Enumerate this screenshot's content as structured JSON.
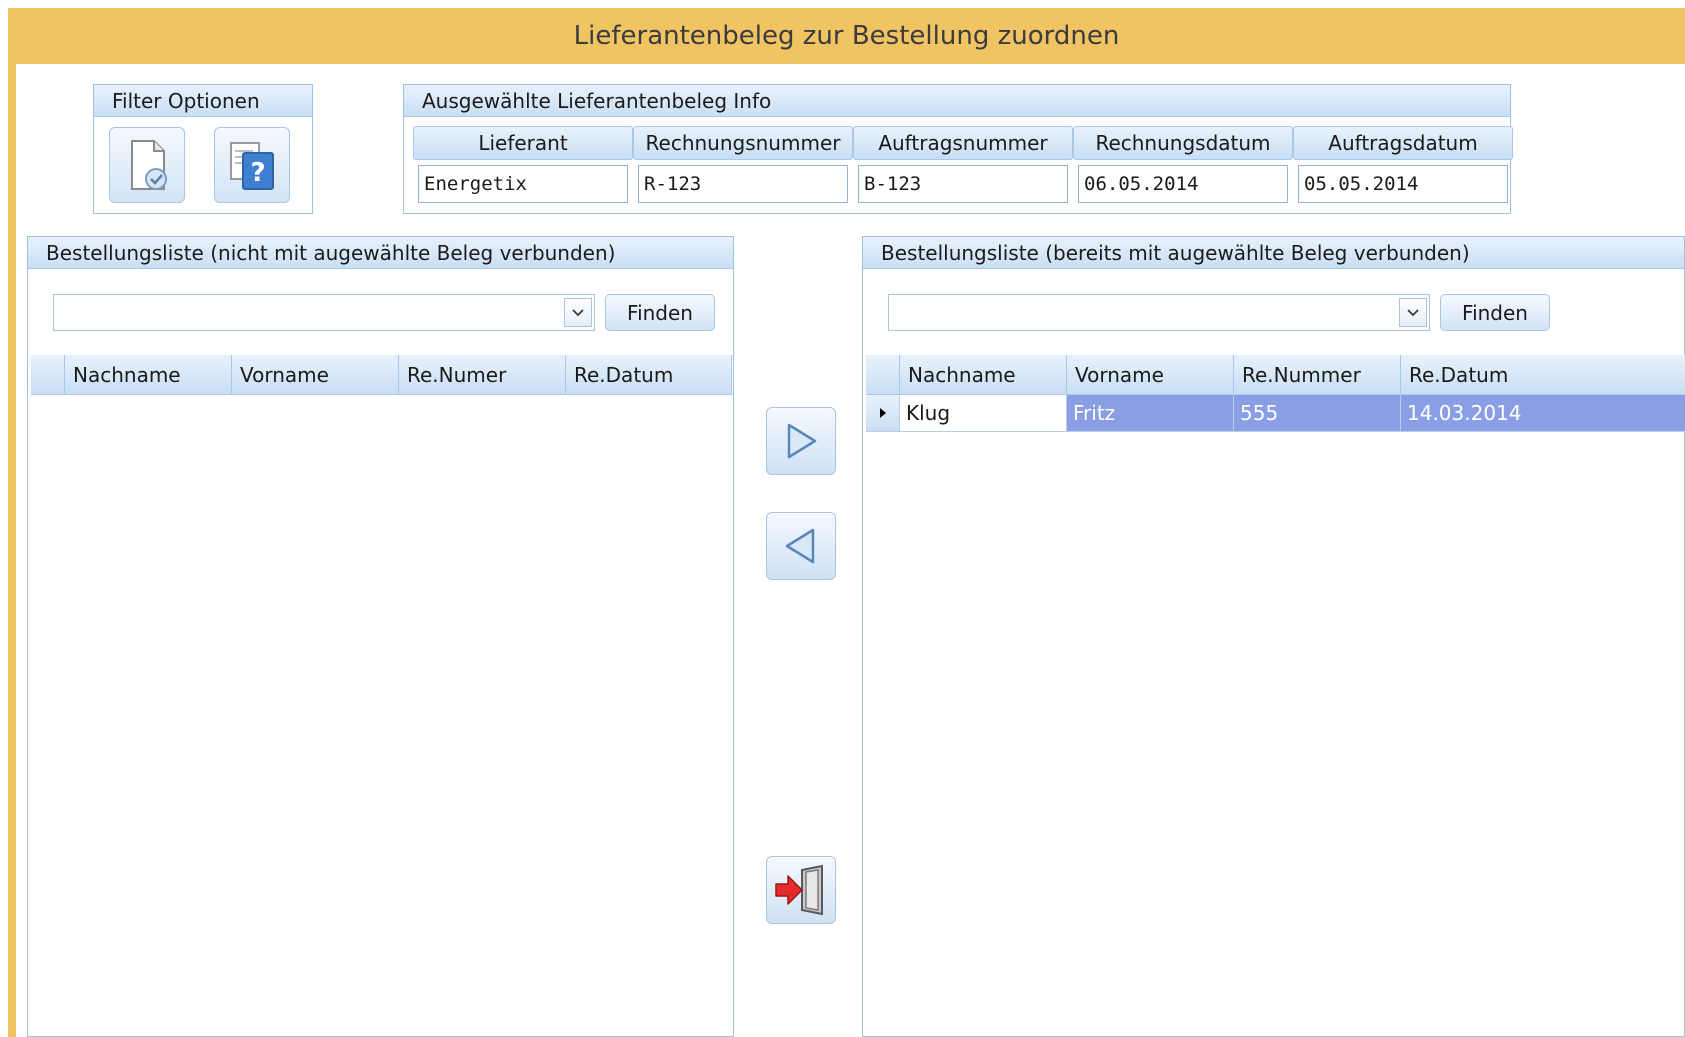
{
  "window": {
    "title": "Lieferantenbeleg zur Bestellung zuordnen"
  },
  "filter": {
    "title": "Filter Optionen",
    "buttons": [
      {
        "icon": "document-check-icon"
      },
      {
        "icon": "document-help-icon"
      }
    ]
  },
  "info": {
    "title": "Ausgewählte Lieferantenbeleg Info",
    "fields": [
      {
        "label": "Lieferant",
        "value": "Energetix"
      },
      {
        "label": "Rechnungsnummer",
        "value": "R-123"
      },
      {
        "label": "Auftragsnummer",
        "value": "B-123"
      },
      {
        "label": "Rechnungsdatum",
        "value": "06.05.2014"
      },
      {
        "label": "Auftragsdatum",
        "value": "05.05.2014"
      }
    ]
  },
  "left_list": {
    "title": "Bestellungsliste (nicht mit augewählte Beleg verbunden)",
    "search_value": "",
    "find_label": "Finden",
    "columns": [
      "Nachname",
      "Vorname",
      "Re.Numer",
      "Re.Datum"
    ],
    "rows": []
  },
  "right_list": {
    "title": "Bestellungsliste (bereits mit  augewählte Beleg verbunden)",
    "search_value": "",
    "find_label": "Finden",
    "columns": [
      "Nachname",
      "Vorname",
      "Re.Nummer",
      "Re.Datum"
    ],
    "rows": [
      {
        "nachname": "Klug",
        "vorname": "Fritz",
        "nummer": "555",
        "datum": "14.03.2014"
      }
    ]
  },
  "actions": {
    "assign_icon": "arrow-right-icon",
    "unassign_icon": "arrow-left-icon",
    "exit_icon": "exit-door-icon"
  },
  "colors": {
    "title_bar": "#f0c463",
    "selection": "#8a9ee6",
    "header_gradient_top": "#e9f2fc",
    "header_gradient_bottom": "#c9def4"
  }
}
